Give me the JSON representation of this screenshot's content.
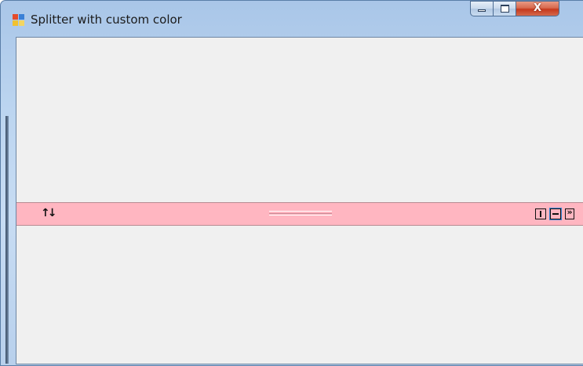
{
  "window": {
    "title": "Splitter with custom color",
    "controls": {
      "minimize": "minimize",
      "maximize": "maximize",
      "close_glyph": "X"
    }
  },
  "splitter": {
    "color": "#ffb6c1",
    "orientation_icon": "swap-vertical-icon",
    "swap_glyph": "↑↓",
    "buttons": [
      {
        "name": "vertical-split-icon"
      },
      {
        "name": "horizontal-split-icon",
        "selected": true
      },
      {
        "name": "collapse-panel-icon",
        "glyph": "»"
      }
    ]
  },
  "colors": {
    "client_background": "#f0f0f0",
    "splitter_background": "#ffb6c1",
    "selection_accent": "#3a86d6"
  }
}
